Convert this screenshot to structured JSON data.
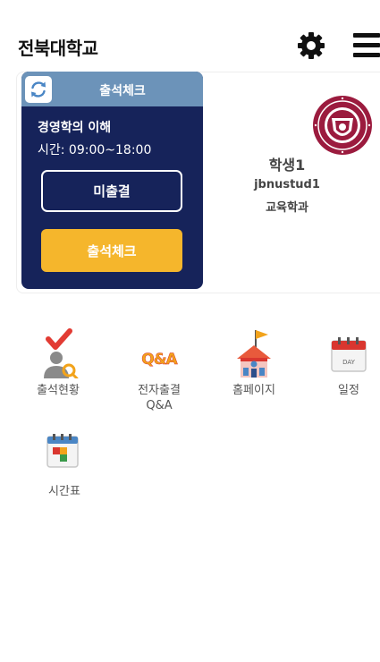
{
  "header": {
    "title": "전북대학교",
    "icons": [
      "gear-icon",
      "hamburger-menu-icon"
    ]
  },
  "attendance_card": {
    "refresh_icon": "refresh-icon",
    "title": "출석체크",
    "course_name": "경영학의 이해",
    "course_time": "시간: 09:00~18:00",
    "absent_label": "미출결",
    "check_label": "출석체크",
    "colors": {
      "card_bg": "#16235a",
      "card_header": "#6c93b9",
      "check_button": "#f5b62c"
    }
  },
  "student": {
    "logo": "university-seal-icon",
    "name": "학생1",
    "id": "jbnustud1",
    "department": "교육학과"
  },
  "menu": [
    {
      "label": "출석현황",
      "icon": "attendance-status-icon"
    },
    {
      "label": "전자출결\nQ&A",
      "icon": "qa-icon"
    },
    {
      "label": "홈페이지",
      "icon": "homepage-icon"
    },
    {
      "label": "일정",
      "icon": "calendar-day-icon"
    },
    {
      "label": "시간표",
      "icon": "timetable-icon"
    }
  ]
}
